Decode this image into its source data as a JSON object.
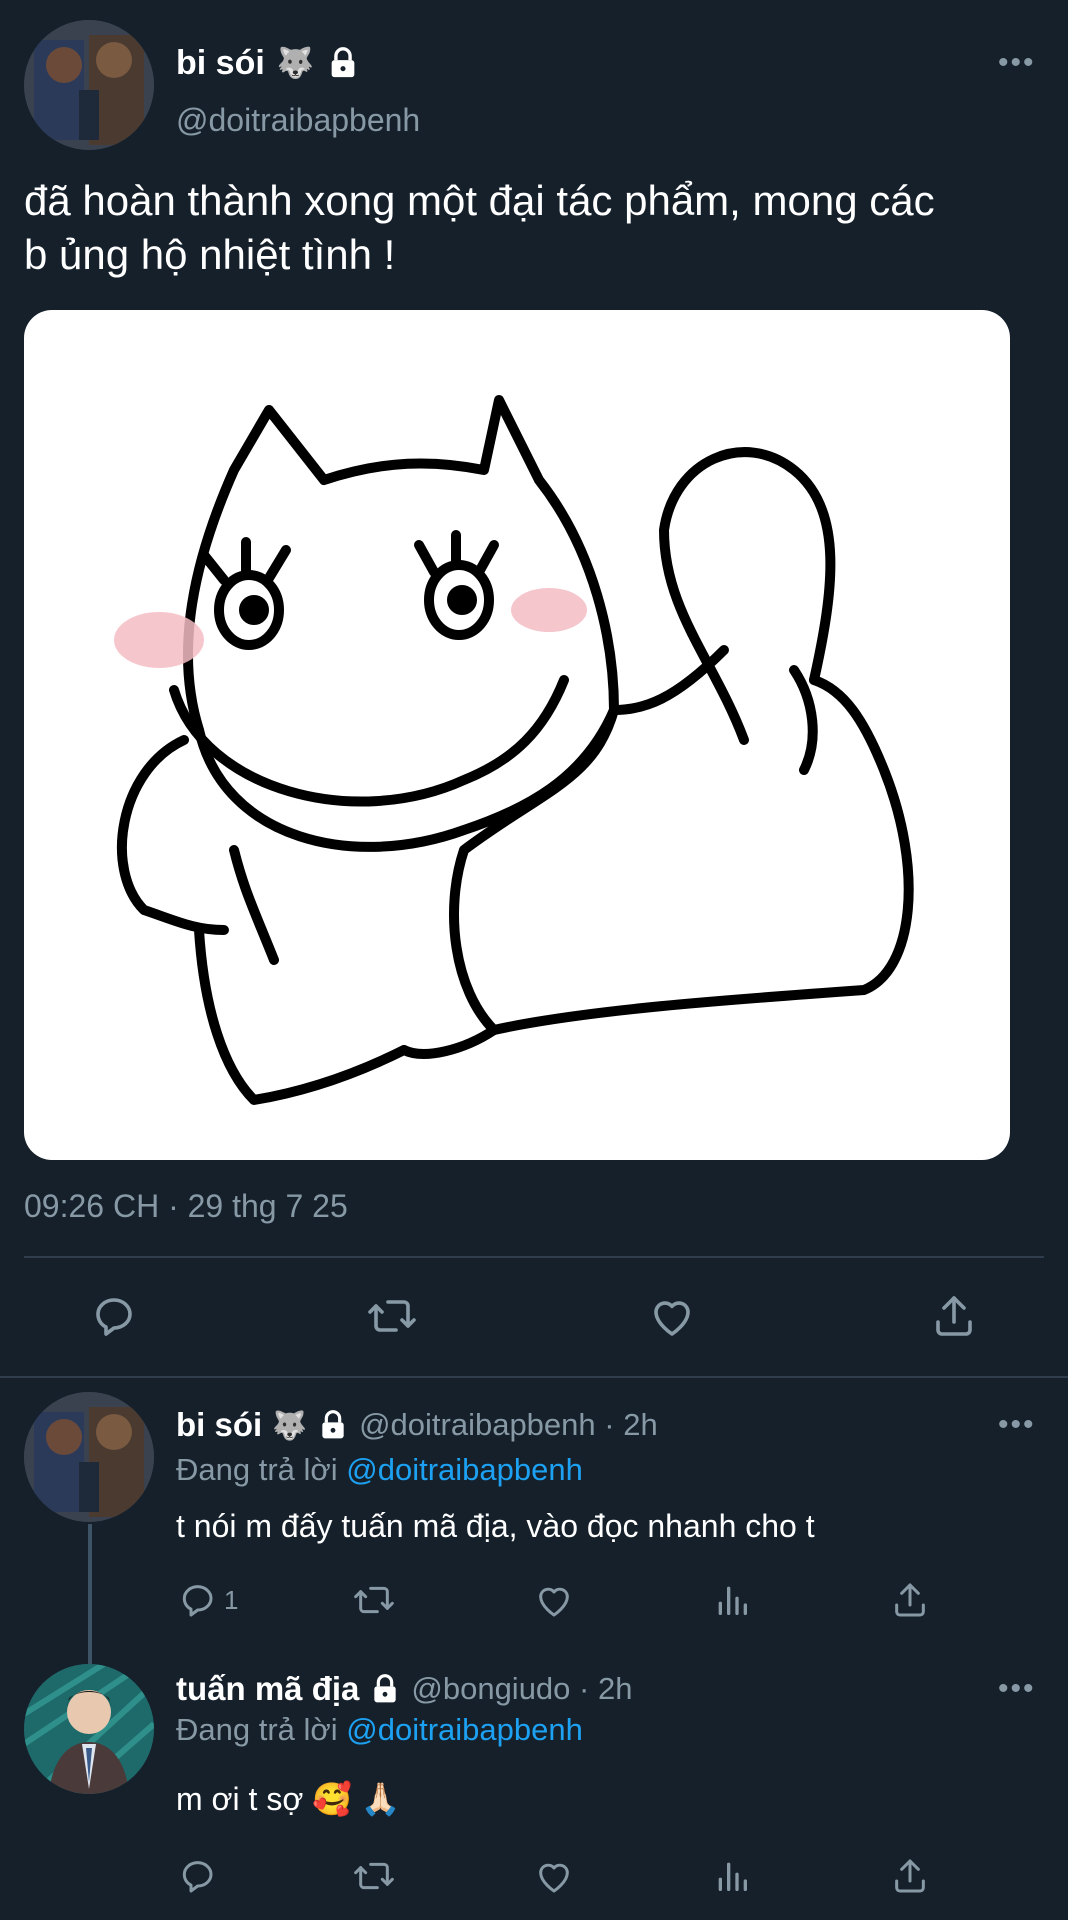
{
  "tweet": {
    "author_name": "bi sói",
    "author_emoji": "🐺",
    "author_handle": "@doitraibapbenh",
    "more_label": "•••",
    "text_line1": "đã hoàn thành xong một đại tác phẩm, mong các",
    "text_line2": "b ủng hộ nhiệt tình !",
    "timestamp": "09:26 CH · 29 thg 7 25"
  },
  "replies": [
    {
      "author_name": "bi sói",
      "author_emoji": "🐺",
      "handle_time": "@doitraibapbenh · 2h",
      "replying_prefix": "Đang trả lời",
      "replying_to": "@doitraibapbenh",
      "text": "t nói m đấy tuấn mã địa, vào đọc nhanh cho t",
      "reply_count": "1",
      "more_label": "•••"
    },
    {
      "author_name": "tuấn mã địa",
      "handle_time": "@bongiudo · 2h",
      "replying_prefix": "Đang trả lời",
      "replying_to": "@doitraibapbenh",
      "text": "m ơi t sợ 🥰 🙏🏻",
      "more_label": "•••"
    }
  ],
  "colors": {
    "background": "#15202b",
    "secondary_text": "#8899a6",
    "link": "#1da1f2",
    "divider": "#2f3d4c"
  },
  "icons": [
    "lock-icon",
    "reply-icon",
    "retweet-icon",
    "like-icon",
    "share-icon",
    "analytics-icon",
    "more-icon"
  ]
}
